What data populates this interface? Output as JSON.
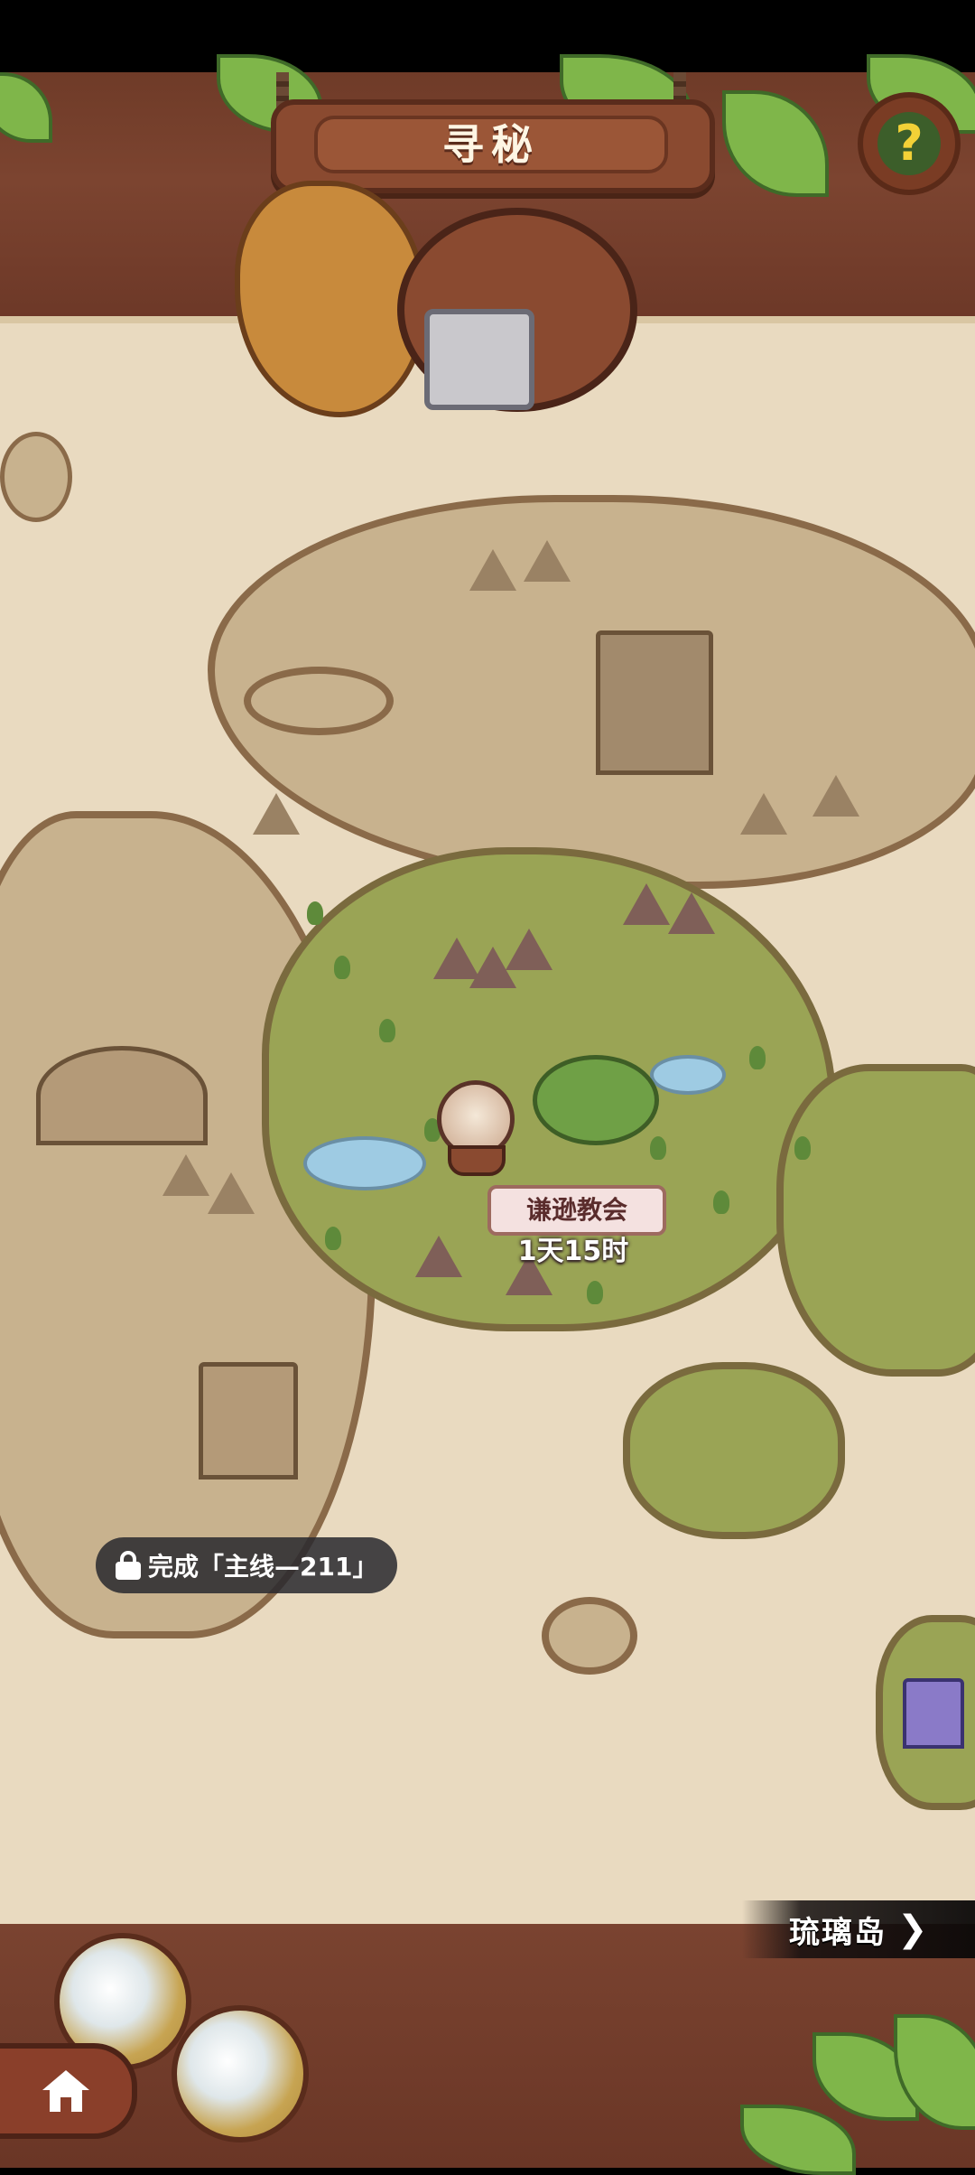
{
  "header": {
    "title": "寻秘",
    "help_icon_glyph": "?"
  },
  "map": {
    "location": {
      "name": "谦逊教会",
      "countdown": "1天15时"
    },
    "locked_region": {
      "requirement": "完成「主线—211」"
    }
  },
  "navigation": {
    "next_island_label": "琉璃岛",
    "chevron_glyph": "❯"
  },
  "colors": {
    "wood": "#7c4430",
    "paper": "#e9dac0",
    "forest": "#9aa455",
    "leaf": "#7fb64a"
  },
  "icons": [
    "question-mark-icon",
    "lock-icon",
    "chevron-right-icon",
    "home-icon",
    "airship-icon"
  ]
}
